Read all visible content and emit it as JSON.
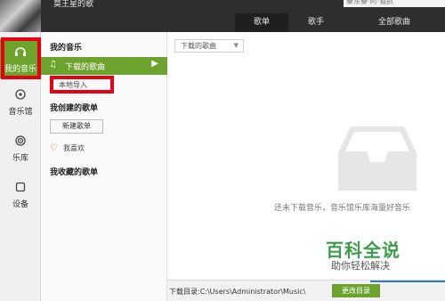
{
  "header": {
    "username": "莫王星的歌",
    "search_text": "秦东秦·阿·猫抓"
  },
  "tabs": [
    {
      "label": "歌单",
      "active": true
    },
    {
      "label": "歌手",
      "active": false
    },
    {
      "label": "全部歌曲",
      "active": false
    }
  ],
  "leftnav": [
    {
      "label": "我的音乐",
      "icon": "headphones-icon",
      "active": true
    },
    {
      "label": "音乐馆",
      "icon": "music-hall-icon",
      "active": false
    },
    {
      "label": "乐库",
      "icon": "library-icon",
      "active": false
    },
    {
      "label": "设备",
      "icon": "device-icon",
      "active": false
    }
  ],
  "col2": {
    "my_music_title": "我的音乐",
    "downloaded_label": "下载的歌曲",
    "local_import_label": "本地导入",
    "created_title": "我创建的歌单",
    "new_playlist_label": "新建歌单",
    "like_label": "我喜欢",
    "collected_title": "我收藏的歌单"
  },
  "main": {
    "dropdown_value": "下载的歌曲",
    "empty_text": "还未下载音乐，音乐馆乐库海量好音乐",
    "download_dir_label": "下载目录:",
    "download_dir_path": "C:\\Users\\Administrator\\Music\\",
    "change_dir_button": "更改目录"
  },
  "watermark": {
    "line1": "百科全说",
    "line2": "助你轻松解决"
  },
  "colors": {
    "accent_green": "#6ca32d",
    "highlight_red": "#e60012",
    "header_dark": "#2e2e2e"
  }
}
